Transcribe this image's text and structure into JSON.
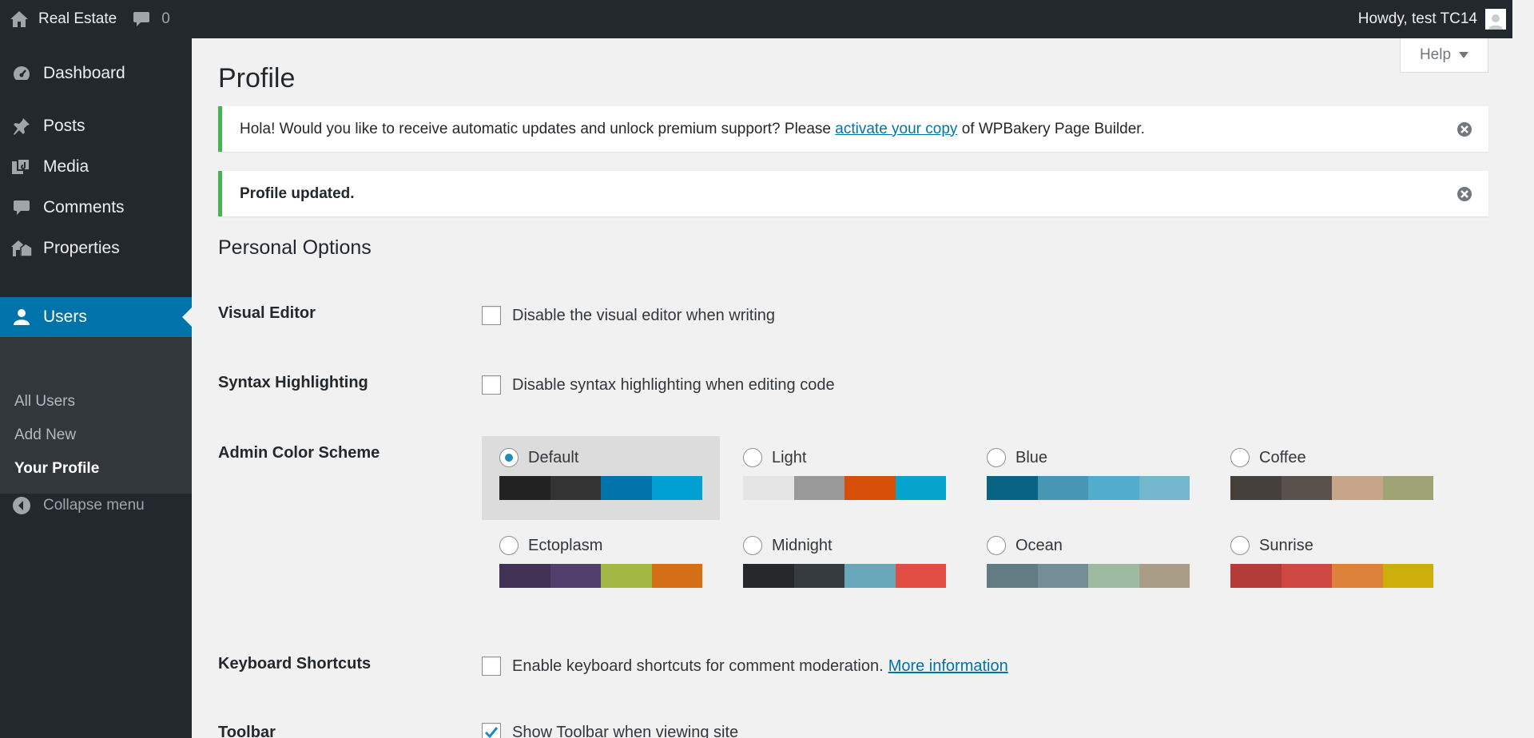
{
  "adminbar": {
    "site_name": "Real Estate",
    "comments_count": "0",
    "greeting": "Howdy, test TC14"
  },
  "sidebar": {
    "items": [
      {
        "label": "Dashboard",
        "icon": "dashboard-icon"
      },
      {
        "label": "Posts",
        "icon": "pin-icon"
      },
      {
        "label": "Media",
        "icon": "media-icon"
      },
      {
        "label": "Comments",
        "icon": "comment-icon"
      },
      {
        "label": "Properties",
        "icon": "properties-icon"
      },
      {
        "label": "Users",
        "icon": "user-icon",
        "current": true
      }
    ],
    "submenu": [
      "All Users",
      "Add New",
      "Your Profile"
    ],
    "collapse_label": "Collapse menu"
  },
  "help_label": "Help",
  "page_title": "Profile",
  "notices": {
    "wpbakery": {
      "before": "Hola! Would you like to receive automatic updates and unlock premium support? Please ",
      "link": "activate your copy",
      "after": " of WPBakery Page Builder."
    },
    "updated": "Profile updated."
  },
  "section_title": "Personal Options",
  "options": {
    "visual_editor": {
      "label": "Visual Editor",
      "text": "Disable the visual editor when writing",
      "checked": false
    },
    "syntax": {
      "label": "Syntax Highlighting",
      "text": "Disable syntax highlighting when editing code",
      "checked": false
    },
    "color_scheme_label": "Admin Color Scheme",
    "keyboard": {
      "label": "Keyboard Shortcuts",
      "text": "Enable keyboard shortcuts for comment moderation.",
      "link": "More information",
      "checked": false
    },
    "toolbar": {
      "label": "Toolbar",
      "text": "Show Toolbar when viewing site",
      "checked": true
    }
  },
  "color_schemes": [
    {
      "name": "Default",
      "selected": true,
      "colors": [
        "#222222",
        "#333333",
        "#0073aa",
        "#00a0d2"
      ]
    },
    {
      "name": "Light",
      "selected": false,
      "colors": [
        "#e5e5e5",
        "#999999",
        "#d64e07",
        "#04a4cc"
      ]
    },
    {
      "name": "Blue",
      "selected": false,
      "colors": [
        "#096484",
        "#4796b3",
        "#52accc",
        "#74b6ce"
      ]
    },
    {
      "name": "Coffee",
      "selected": false,
      "colors": [
        "#46403c",
        "#59524c",
        "#c7a589",
        "#9ea476"
      ]
    },
    {
      "name": "Ectoplasm",
      "selected": false,
      "colors": [
        "#413256",
        "#523f6d",
        "#a3b745",
        "#d46f15"
      ]
    },
    {
      "name": "Midnight",
      "selected": false,
      "colors": [
        "#25282b",
        "#363b3f",
        "#69a8bb",
        "#e14d43"
      ]
    },
    {
      "name": "Ocean",
      "selected": false,
      "colors": [
        "#627c83",
        "#738e96",
        "#9ebaa0",
        "#aa9d88"
      ]
    },
    {
      "name": "Sunrise",
      "selected": false,
      "colors": [
        "#b43c38",
        "#cf4944",
        "#dd823b",
        "#ccaf0b"
      ]
    }
  ],
  "colors": {
    "accent": "#0073aa",
    "notice_border": "#46b450",
    "sidebar_bg": "#23282d"
  }
}
